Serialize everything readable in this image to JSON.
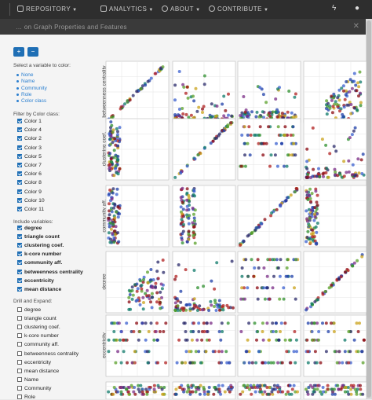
{
  "navbar": {
    "items": [
      {
        "label": "REPOSITORY"
      },
      {
        "label": "ANALYTICS"
      },
      {
        "label": "ABOUT"
      },
      {
        "label": "CONTRIBUTE"
      }
    ],
    "right_icons": [
      "bolt-icon",
      "user-icon"
    ]
  },
  "window": {
    "title": "… on Graph Properties and Features",
    "close_label": "✕"
  },
  "zoom": {
    "in_label": "+",
    "out_label": "−"
  },
  "color_select": {
    "heading": "Select a variable to color:",
    "options": [
      "None",
      "Name",
      "Community",
      "Role",
      "Color class"
    ]
  },
  "filter": {
    "heading": "Filter by Color class:",
    "items": [
      {
        "label": "Color 1",
        "checked": true
      },
      {
        "label": "Color 4",
        "checked": true
      },
      {
        "label": "Color 2",
        "checked": true
      },
      {
        "label": "Color 3",
        "checked": true
      },
      {
        "label": "Color 5",
        "checked": true
      },
      {
        "label": "Color 7",
        "checked": true
      },
      {
        "label": "Color 6",
        "checked": true
      },
      {
        "label": "Color 8",
        "checked": true
      },
      {
        "label": "Color 9",
        "checked": true
      },
      {
        "label": "Color 10",
        "checked": true
      },
      {
        "label": "Color 11",
        "checked": true
      }
    ]
  },
  "variables": {
    "heading": "Include variables:",
    "items": [
      {
        "label": "degree",
        "checked": true
      },
      {
        "label": "triangle count",
        "checked": true
      },
      {
        "label": "clustering coef.",
        "checked": true
      },
      {
        "label": "k-core number",
        "checked": true
      },
      {
        "label": "community aff.",
        "checked": true
      },
      {
        "label": "betweenness centrality",
        "checked": true
      },
      {
        "label": "eccentricity",
        "checked": true
      },
      {
        "label": "mean distance",
        "checked": true
      }
    ]
  },
  "drill": {
    "heading": "Drill and Expand:",
    "items": [
      {
        "label": "degree",
        "checked": false
      },
      {
        "label": "triangle count",
        "checked": false
      },
      {
        "label": "clustering coef.",
        "checked": false
      },
      {
        "label": "k-core number",
        "checked": false
      },
      {
        "label": "community aff.",
        "checked": false
      },
      {
        "label": "betweenness centrality",
        "checked": false
      },
      {
        "label": "eccentricity",
        "checked": false
      },
      {
        "label": "mean distance",
        "checked": false
      },
      {
        "label": "Name",
        "checked": false
      },
      {
        "label": "Community",
        "checked": false
      },
      {
        "label": "Role",
        "checked": false
      }
    ]
  },
  "matrix": {
    "row_labels": [
      "betweenness centrality",
      "clustering coef.",
      "community aff.",
      "degree",
      "eccentricity",
      ""
    ],
    "colors": [
      "#1f3fa8",
      "#8b0a12",
      "#2f8f2f",
      "#7a2c86",
      "#0f7a6a",
      "#b02020",
      "#3a5fcf",
      "#5aa02a",
      "#caa21a",
      "#2a2a6a"
    ]
  }
}
